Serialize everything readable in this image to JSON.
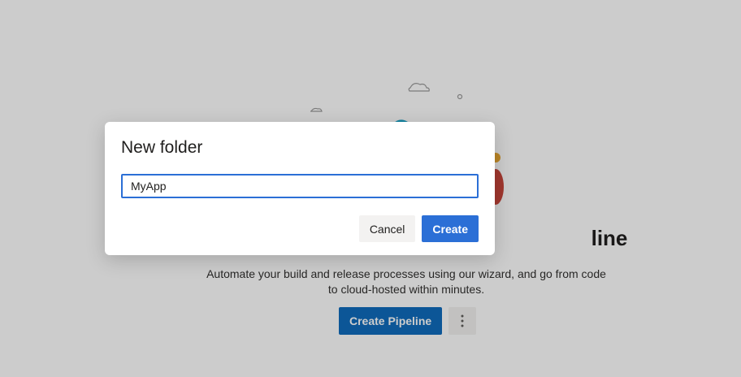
{
  "background": {
    "heading_visible_fragment": "line",
    "description": "Automate your build and release processes using our wizard, and go from code to cloud-hosted within minutes.",
    "create_pipeline_label": "Create Pipeline",
    "more_options_icon": "more-vertical-icon"
  },
  "dialog": {
    "title": "New folder",
    "input_value": "MyApp",
    "cancel_label": "Cancel",
    "create_label": "Create"
  },
  "colors": {
    "primary": "#2b6fd6",
    "overlay": "rgba(0,0,0,0.2)"
  }
}
